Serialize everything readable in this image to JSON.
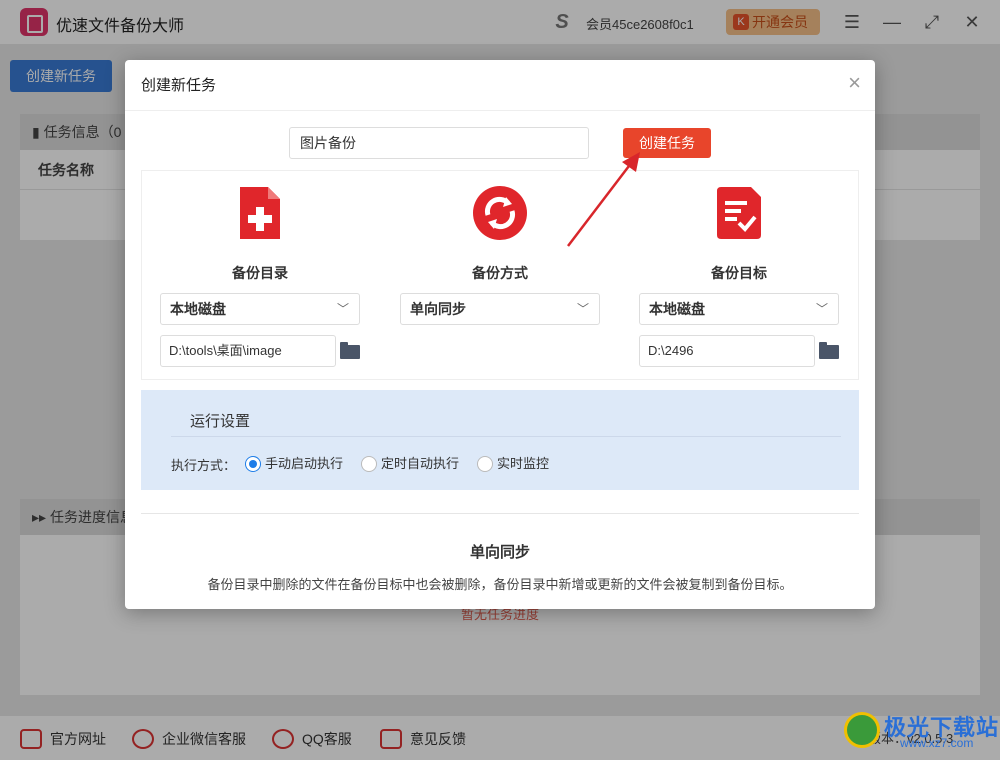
{
  "app": {
    "title": "优速文件备份大师",
    "member_label": "会员45ce2608f0c1",
    "vip_button": "开通会员",
    "vip_icon": "K",
    "window_controls": {
      "menu": "☰",
      "minimize": "—",
      "maximize": "⤢",
      "close": "✕"
    }
  },
  "background": {
    "create_button": "创建新任务",
    "task_panel_title": "任务信息（0",
    "task_col_name": "任务名称",
    "progress_panel_title": "任务进度信息",
    "progress_hint": "暂无任务进度"
  },
  "footer": {
    "items": [
      {
        "label": "官方网址",
        "icon": "website-icon"
      },
      {
        "label": "企业微信客服",
        "icon": "wecom-icon"
      },
      {
        "label": "QQ客服",
        "icon": "qq-icon"
      },
      {
        "label": "意见反馈",
        "icon": "feedback-icon"
      }
    ],
    "version": "版本：v2.0.5.3"
  },
  "watermark": {
    "text": "极光下载站",
    "sub": "www.xz7.com"
  },
  "dialog": {
    "title": "创建新任务",
    "close": "×",
    "task_name_value": "图片备份",
    "create_button": "创建任务",
    "columns": [
      {
        "label": "备份目录",
        "select": "本地磁盘",
        "path": "D:\\tools\\桌面\\image"
      },
      {
        "label": "备份方式",
        "select": "单向同步"
      },
      {
        "label": "备份目标",
        "select": "本地磁盘",
        "path": "D:\\2496"
      }
    ],
    "run": {
      "title": "运行设置",
      "mode_label": "执行方式：",
      "options": [
        "手动启动执行",
        "定时自动执行",
        "实时监控"
      ],
      "selected": "手动启动执行"
    },
    "desc": {
      "title": "单向同步",
      "text": "备份目录中删除的文件在备份目标中也会被删除，备份目录中新增或更新的文件会被复制到备份目标。"
    }
  },
  "colors": {
    "accent_red": "#e8452b",
    "primary_blue": "#3a7bd5",
    "panel_blue": "#dde9f8"
  }
}
